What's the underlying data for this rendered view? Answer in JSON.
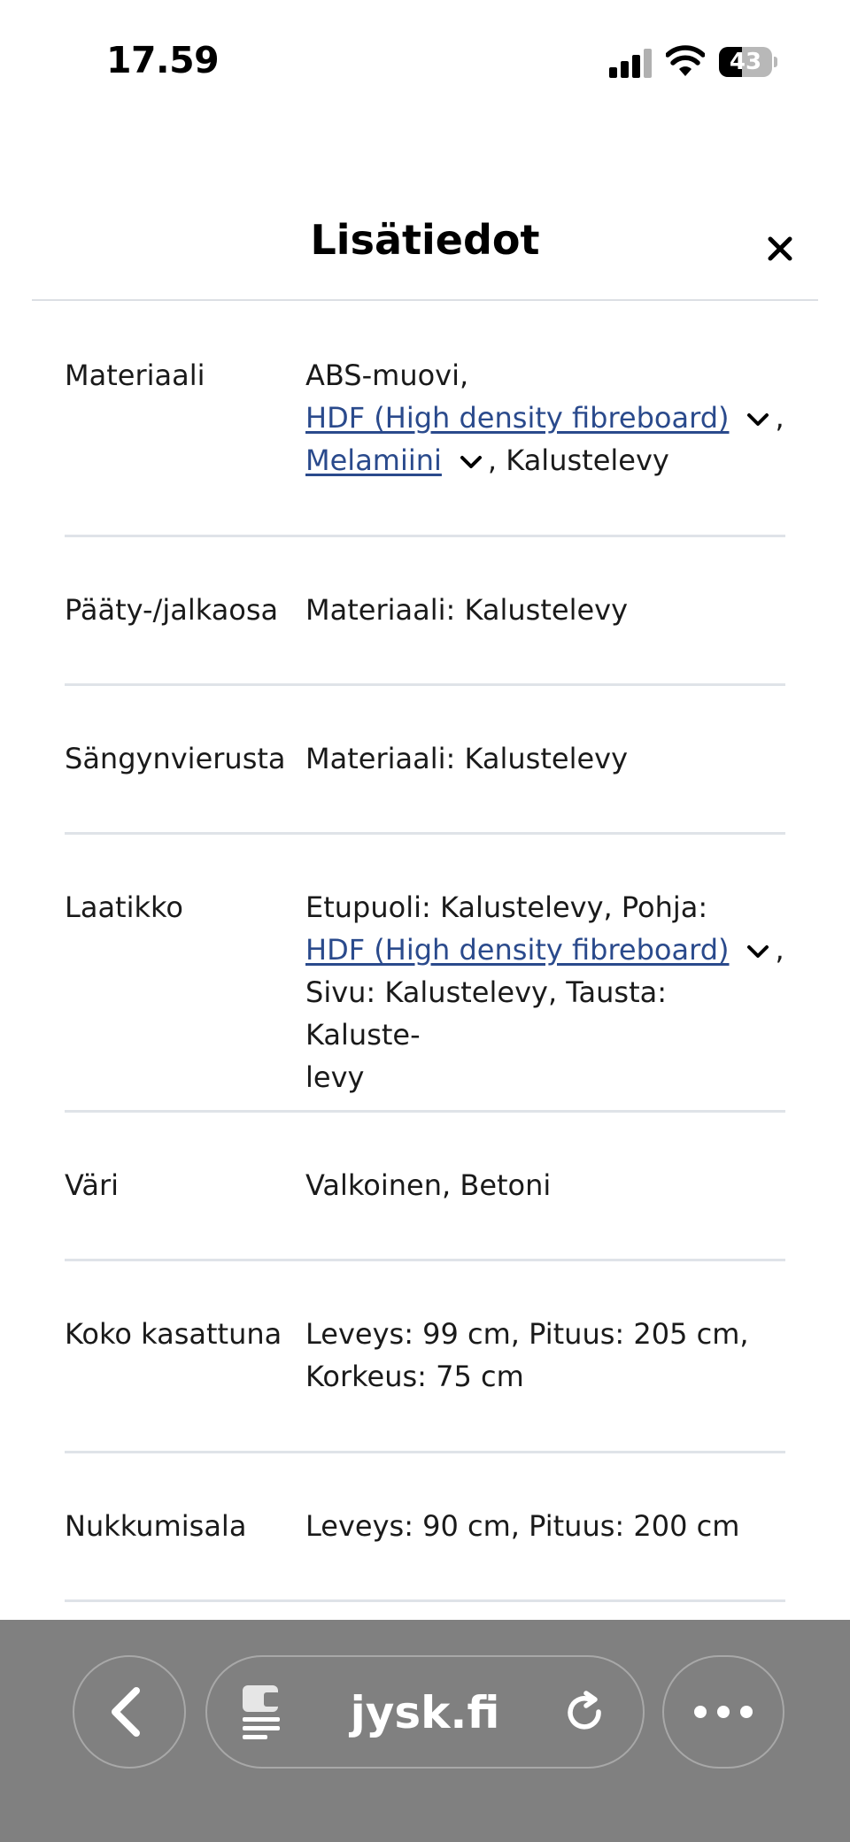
{
  "status_bar": {
    "time": "17.59",
    "battery": "43",
    "battery_level": 0.43,
    "icons": [
      "signal-icon",
      "wifi-icon",
      "battery-icon"
    ]
  },
  "modal": {
    "title": "Lisätiedot",
    "close_icon": "close-icon"
  },
  "details": {
    "materiaali": {
      "label": "Materiaali",
      "part1": "ABS-muovi,",
      "link1": "HDF (High density fibreboard)",
      "sep1": ",",
      "link2": "Melamiini",
      "sep2": ", Kalustelevy"
    },
    "paaty": {
      "label": "Pääty-/jalkaosa",
      "value": "Materiaali: Kalustelevy"
    },
    "sangynvierusta": {
      "label": "Sängynvierusta",
      "value": "Materiaali: Kalustelevy"
    },
    "laatikko": {
      "label": "Laatikko",
      "part1": "Etupuoli: Kalustelevy, Pohja:",
      "link1": "HDF (High density fibreboard)",
      "sep1": ",",
      "part2": "Sivu: Kalustelevy, Tausta: Kaluste-",
      "part3": "levy"
    },
    "vari": {
      "label": "Väri",
      "value": "Valkoinen, Betoni"
    },
    "koko": {
      "label": "Koko kasattuna",
      "line1": "Leveys: 99 cm, Pituus: 205 cm,",
      "line2": "Korkeus: 75 cm"
    },
    "nukkumisala": {
      "label": "Nukkumisala",
      "value": "Leveys: 90 cm, Pituus: 200 cm"
    }
  },
  "browser_bar": {
    "domain": "jysk.fi",
    "icons": [
      "back-arrow-icon",
      "reader-icon",
      "reload-icon",
      "more-icon"
    ]
  }
}
